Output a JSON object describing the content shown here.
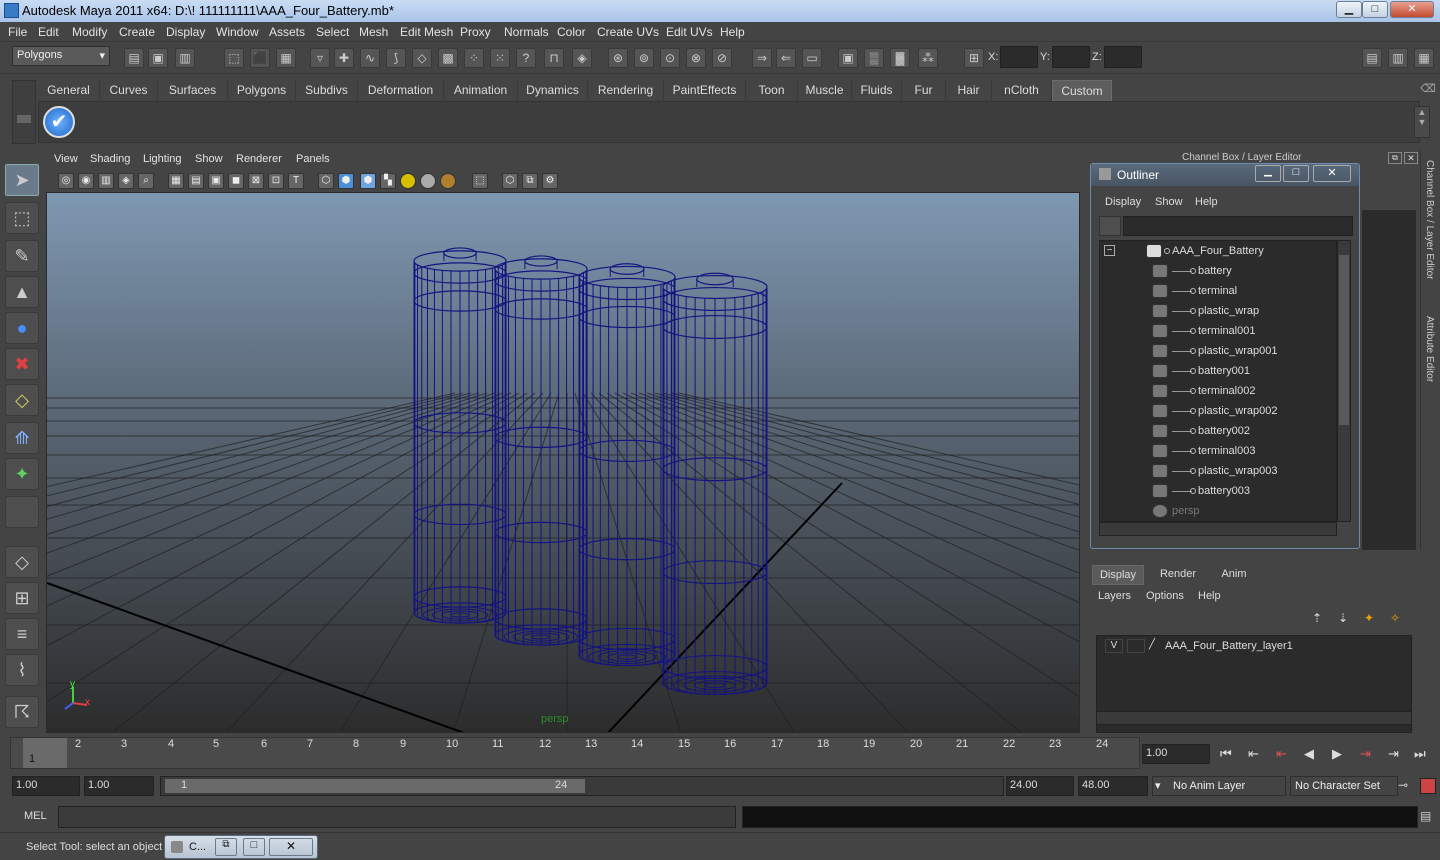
{
  "window": {
    "title": "Autodesk Maya 2011 x64: D:\\! 111111111\\AAA_Four_Battery.mb*",
    "minimize": "▁",
    "maximize": "□",
    "close": "✕"
  },
  "menubar": [
    "File",
    "Edit",
    "Modify",
    "Create",
    "Display",
    "Window",
    "Assets",
    "Select",
    "Mesh",
    "Edit Mesh",
    "Proxy",
    "Normals",
    "Color",
    "Create UVs",
    "Edit UVs",
    "Help"
  ],
  "status": {
    "mode": "Polygons",
    "x_label": "X:",
    "y_label": "Y:",
    "z_label": "Z:"
  },
  "shelf_tabs": [
    "General",
    "Curves",
    "Surfaces",
    "Polygons",
    "Subdivs",
    "Deformation",
    "Animation",
    "Dynamics",
    "Rendering",
    "PaintEffects",
    "Toon",
    "Muscle",
    "Fluids",
    "Fur",
    "Hair",
    "nCloth",
    "Custom"
  ],
  "shelf_active": "Custom",
  "viewport": {
    "menu": [
      "View",
      "Shading",
      "Lighting",
      "Show",
      "Renderer",
      "Panels"
    ],
    "camera_label": "persp",
    "axis_x": "x",
    "axis_y": "y"
  },
  "channel_box_title": "Channel Box / Layer Editor",
  "right_strip": {
    "tab1": "Channel Box / Layer Editor",
    "tab2": "Attribute Editor"
  },
  "outliner": {
    "title": "Outliner",
    "minimize": "▁",
    "maximize": "□",
    "close": "✕",
    "menu": [
      "Display",
      "Show",
      "Help"
    ],
    "root": "AAA_Four_Battery",
    "items": [
      "battery",
      "terminal",
      "plastic_wrap",
      "terminal001",
      "plastic_wrap001",
      "battery001",
      "terminal002",
      "plastic_wrap002",
      "battery002",
      "terminal003",
      "plastic_wrap003",
      "battery003"
    ],
    "camera": "persp"
  },
  "layers": {
    "tabs": [
      "Display",
      "Render",
      "Anim"
    ],
    "active_tab": "Display",
    "menu": [
      "Layers",
      "Options",
      "Help"
    ],
    "visibility": "V",
    "layer_name": "AAA_Four_Battery_layer1"
  },
  "timeline": {
    "ticks": [
      "1",
      "2",
      "3",
      "4",
      "5",
      "6",
      "7",
      "8",
      "9",
      "10",
      "11",
      "12",
      "13",
      "14",
      "15",
      "16",
      "17",
      "18",
      "19",
      "20",
      "21",
      "22",
      "23",
      "24"
    ],
    "current_frame": "1",
    "current_time": "1.00"
  },
  "range": {
    "start": "1.00",
    "playback_start": "1.00",
    "slider_start": "1",
    "slider_end": "24",
    "playback_end": "24.00",
    "end": "48.00",
    "anim_layer": "No Anim Layer",
    "character_set": "No Character Set"
  },
  "cmdline": {
    "label": "MEL"
  },
  "helpline": {
    "text": "Select Tool: select an object",
    "task_label": "C..."
  }
}
